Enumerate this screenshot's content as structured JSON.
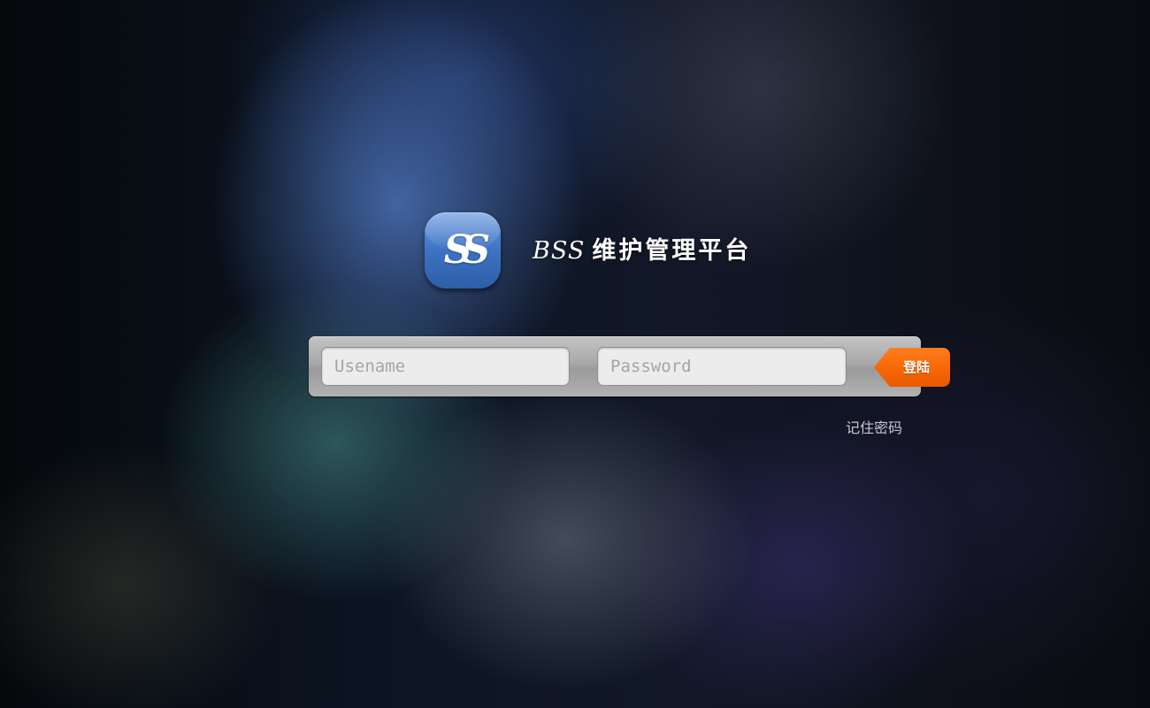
{
  "logo": {
    "text": "SS"
  },
  "title": {
    "brand": "BSS",
    "text": "维护管理平台"
  },
  "login": {
    "username_placeholder": "Usename",
    "password_placeholder": "Password",
    "button_label": "登陆",
    "remember_label": "记住密码"
  },
  "colors": {
    "accent": "#f76706",
    "logo_blue": "#3e74c4",
    "bar_gray": "#a8a8a8"
  }
}
